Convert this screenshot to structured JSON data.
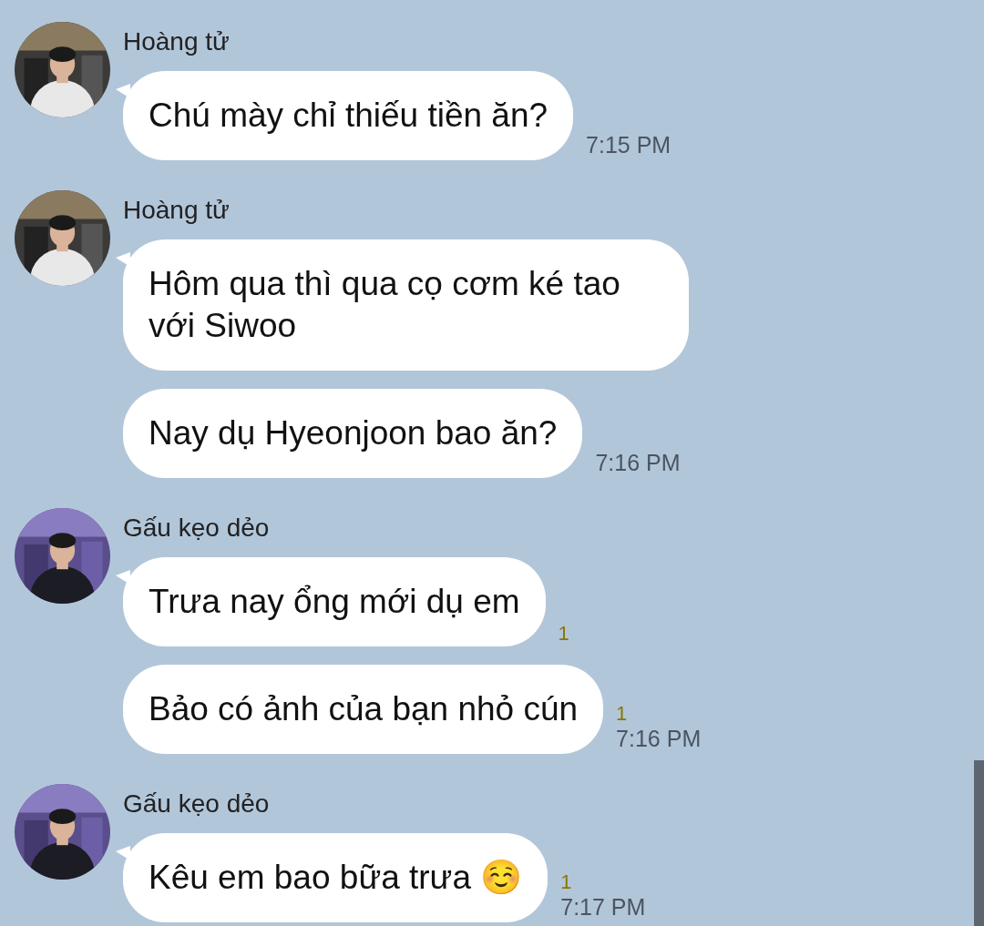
{
  "groups": [
    {
      "sender": "Hoàng tử",
      "messages": [
        {
          "text": "Chú mày chỉ thiếu tiền ăn?",
          "time": "7:15 PM"
        }
      ]
    },
    {
      "sender": "Hoàng tử",
      "messages": [
        {
          "text": "Hôm qua thì qua cọ cơm ké tao với Siwoo"
        },
        {
          "text": "Nay dụ Hyeonjoon bao ăn?",
          "time": "7:16 PM"
        }
      ]
    },
    {
      "sender": "Gấu kẹo dẻo",
      "messages": [
        {
          "text": "Trưa nay ổng mới dụ em",
          "read_count": "1"
        },
        {
          "text": "Bảo có ảnh của bạn nhỏ cún",
          "read_count": "1",
          "time": "7:16 PM"
        }
      ]
    },
    {
      "sender": "Gấu kẹo dẻo",
      "messages": [
        {
          "text": "Kêu em bao bữa trưa ☺️",
          "read_count": "1",
          "time": "7:17 PM"
        }
      ]
    }
  ]
}
